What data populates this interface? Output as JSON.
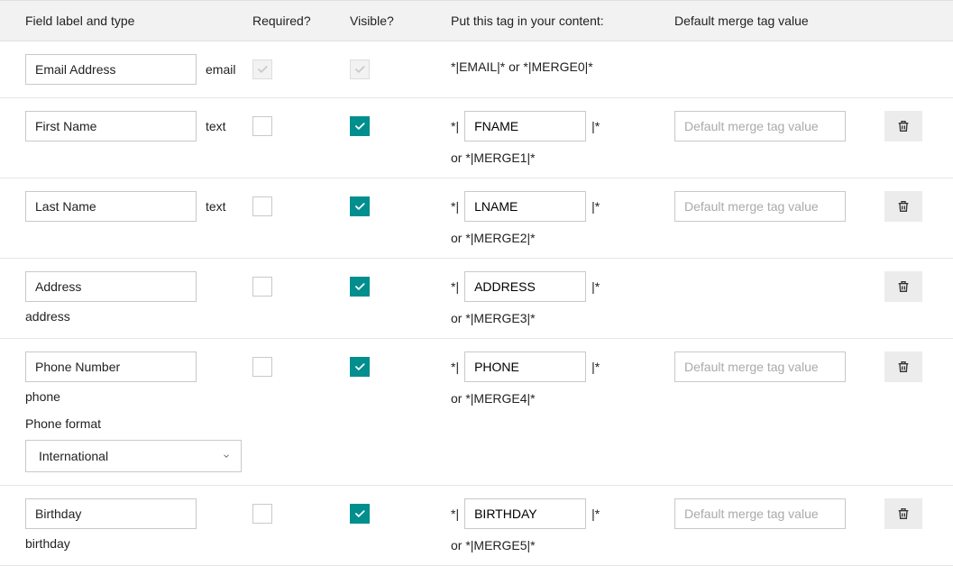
{
  "headers": {
    "label": "Field label and type",
    "required": "Required?",
    "visible": "Visible?",
    "tag": "Put this tag in your content:",
    "default": "Default merge tag value"
  },
  "common": {
    "tag_prefix": "*|",
    "tag_suffix": "|*",
    "or_prefix": "or ",
    "default_placeholder": "Default merge tag value",
    "phone_format_label": "Phone format"
  },
  "rows": [
    {
      "label_value": "Email Address",
      "type_text": "email",
      "type_inline": true,
      "required_checked": true,
      "required_disabled": true,
      "visible_checked": true,
      "visible_disabled": true,
      "tag_static": "*|EMAIL|* or *|MERGE0|*",
      "show_default": false,
      "show_delete": false
    },
    {
      "label_value": "First Name",
      "type_text": "text",
      "type_inline": true,
      "required_checked": false,
      "required_disabled": false,
      "visible_checked": true,
      "visible_disabled": false,
      "tag_input": "FNAME",
      "tag_alt": "*|MERGE1|*",
      "show_default": true,
      "show_delete": true
    },
    {
      "label_value": "Last Name",
      "type_text": "text",
      "type_inline": true,
      "required_checked": false,
      "required_disabled": false,
      "visible_checked": true,
      "visible_disabled": false,
      "tag_input": "LNAME",
      "tag_alt": "*|MERGE2|*",
      "show_default": true,
      "show_delete": true
    },
    {
      "label_value": "Address",
      "type_text": "address",
      "type_inline": false,
      "required_checked": false,
      "required_disabled": false,
      "visible_checked": true,
      "visible_disabled": false,
      "tag_input": "ADDRESS",
      "tag_alt": "*|MERGE3|*",
      "show_default": false,
      "show_delete": true
    },
    {
      "label_value": "Phone Number",
      "type_text": "phone",
      "type_inline": false,
      "required_checked": false,
      "required_disabled": false,
      "visible_checked": true,
      "visible_disabled": false,
      "tag_input": "PHONE",
      "tag_alt": "*|MERGE4|*",
      "show_default": true,
      "show_delete": true,
      "phone_format": "International"
    },
    {
      "label_value": "Birthday",
      "type_text": "birthday",
      "type_inline": false,
      "required_checked": false,
      "required_disabled": false,
      "visible_checked": true,
      "visible_disabled": false,
      "tag_input": "BIRTHDAY",
      "tag_alt": "*|MERGE5|*",
      "show_default": true,
      "show_delete": true
    }
  ]
}
